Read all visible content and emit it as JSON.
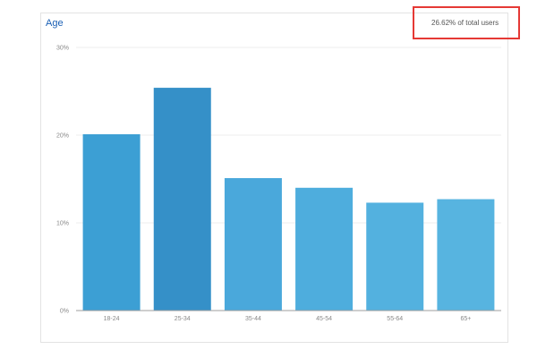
{
  "card": {
    "title": "Age",
    "summary": "26.62% of total users",
    "highlight_color": "#e53935"
  },
  "chart_data": {
    "type": "bar",
    "title": "Age",
    "categories": [
      "18-24",
      "25-34",
      "35-44",
      "45-54",
      "55-64",
      "65+"
    ],
    "values": [
      20.1,
      25.4,
      15.1,
      14.0,
      12.3,
      12.7
    ],
    "y_ticks": [
      "0%",
      "10%",
      "20%",
      "30%"
    ],
    "ylim": [
      0,
      30
    ],
    "grid": true,
    "xlabel": "",
    "ylabel": "",
    "colors": [
      "#3c9fd4",
      "#3590c8",
      "#4aa8db",
      "#4eaddd",
      "#53b1df",
      "#57b4e0"
    ]
  }
}
